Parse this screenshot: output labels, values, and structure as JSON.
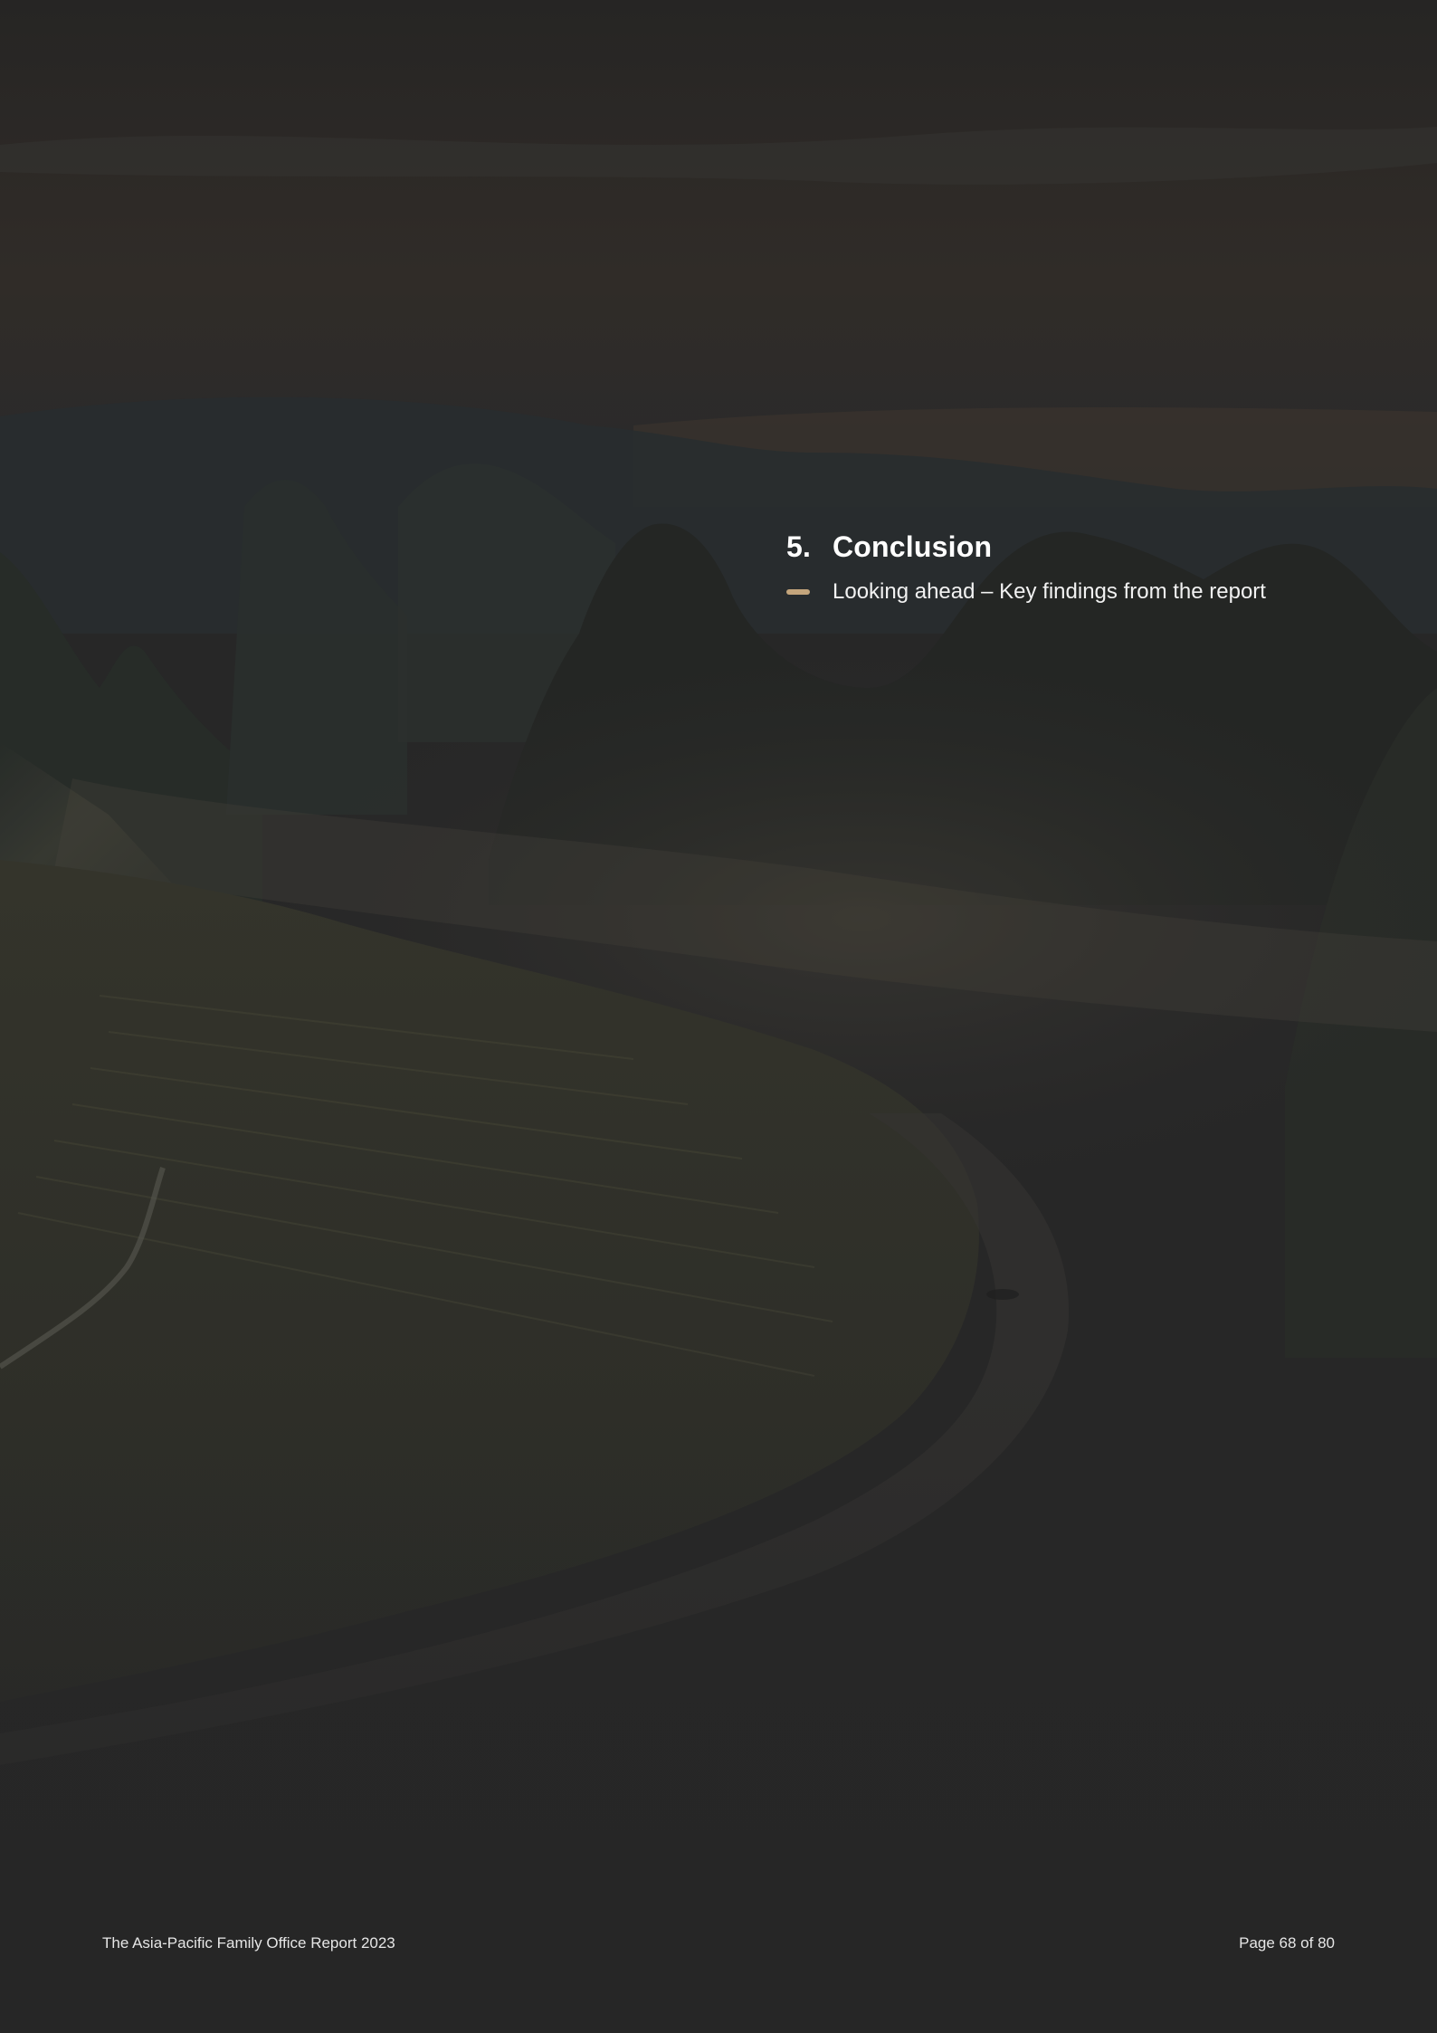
{
  "section": {
    "number": "5.",
    "title": "Conclusion",
    "subtitle": "Looking ahead – Key findings from the report"
  },
  "footer": {
    "report_title": "The Asia-Pacific Family Office Report 2023",
    "page_label": "Page 68 of 80"
  },
  "colors": {
    "accent": "#c4a57c",
    "background": "#2b2b2b",
    "text": "#ffffff"
  }
}
